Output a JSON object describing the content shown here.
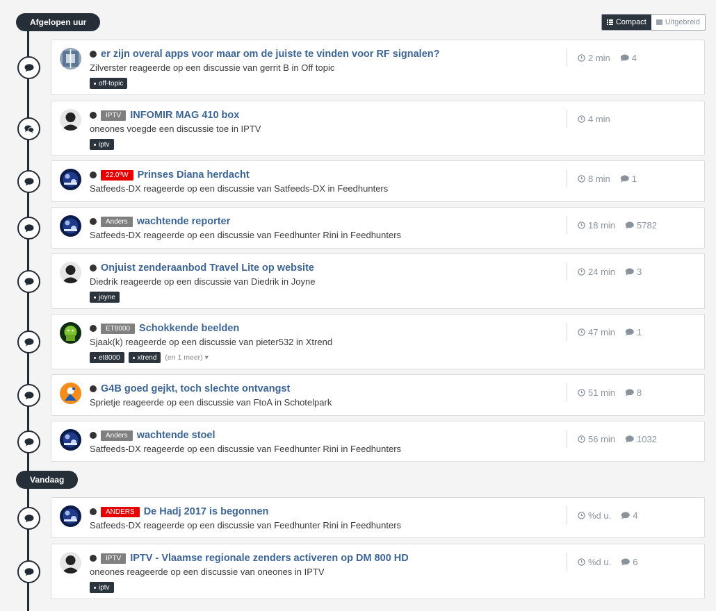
{
  "sections": [
    {
      "label": "Afgelopen uur"
    },
    {
      "label": "Vandaag"
    }
  ],
  "view_switch": {
    "compact_label": "Compact",
    "expanded_label": "Uitgebreid"
  },
  "items": [
    {
      "node_icon": "comment-icon",
      "avatar": "photo",
      "prefix": "",
      "title": "er zijn overal apps voor maar om de juiste te vinden voor RF signalen?",
      "meta": "Zilverster reageerde op een discussie van gerrit B in Off topic",
      "tags": [
        "off-topic"
      ],
      "more": "",
      "time": "2 min",
      "replies": "4"
    },
    {
      "node_icon": "comments-icon",
      "avatar": "default",
      "prefix": "IPTV",
      "prefix_color": "#7f7f7f",
      "title": "INFOMIR MAG 410 box",
      "meta": "oneones voegde een discussie toe in IPTV",
      "tags": [
        "iptv"
      ],
      "more": "",
      "time": "4 min",
      "replies": ""
    },
    {
      "node_icon": "comment-icon",
      "avatar": "satfeeds",
      "prefix": "22.0ºW",
      "prefix_color": "#e60000",
      "title": "Prinses Diana herdacht",
      "meta": "Satfeeds-DX reageerde op een discussie van Satfeeds-DX in Feedhunters",
      "tags": [],
      "more": "",
      "time": "8 min",
      "replies": "1"
    },
    {
      "node_icon": "comment-icon",
      "avatar": "satfeeds",
      "prefix": "Anders",
      "prefix_color": "#7f7f7f",
      "title": "wachtende reporter",
      "meta": "Satfeeds-DX reageerde op een discussie van Feedhunter Rini in Feedhunters",
      "tags": [],
      "more": "",
      "time": "18 min",
      "replies": "5782"
    },
    {
      "node_icon": "comment-icon",
      "avatar": "default",
      "prefix": "",
      "title": "Onjuist zenderaanbod Travel Lite op website",
      "meta": "Diedrik reageerde op een discussie van Diedrik in Joyne",
      "tags": [
        "joyne"
      ],
      "more": "",
      "time": "24 min",
      "replies": "3"
    },
    {
      "node_icon": "comment-icon",
      "avatar": "android",
      "prefix": "ET8000",
      "prefix_color": "#7f7f7f",
      "title": "Schokkende beelden",
      "meta": "Sjaak(k) reageerde op een discussie van pieter532 in Xtrend",
      "tags": [
        "et8000",
        "xtrend"
      ],
      "more": "(en 1 meer)",
      "time": "47 min",
      "replies": "1"
    },
    {
      "node_icon": "comment-icon",
      "avatar": "orange",
      "prefix": "",
      "title": "G4B goed gejkt, toch slechte ontvangst",
      "meta": "Sprietje reageerde op een discussie van FtoA in Schotelpark",
      "tags": [],
      "more": "",
      "time": "51 min",
      "replies": "8"
    },
    {
      "node_icon": "comment-icon",
      "avatar": "satfeeds",
      "prefix": "Anders",
      "prefix_color": "#7f7f7f",
      "title": "wachtende stoel",
      "meta": "Satfeeds-DX reageerde op een discussie van Feedhunter Rini in Feedhunters",
      "tags": [],
      "more": "",
      "time": "56 min",
      "replies": "1032"
    },
    {
      "node_icon": "comment-icon",
      "avatar": "satfeeds",
      "prefix": "ANDERS",
      "prefix_color": "#e60000",
      "title": "De Hadj 2017 is begonnen",
      "meta": "Satfeeds-DX reageerde op een discussie van Feedhunter Rini in Feedhunters",
      "tags": [],
      "more": "",
      "time": "%d u.",
      "replies": "4"
    },
    {
      "node_icon": "comment-icon",
      "avatar": "default",
      "prefix": "IPTV",
      "prefix_color": "#7f7f7f",
      "title": "IPTV - Vlaamse regionale zenders activeren op DM 800 HD",
      "meta": "oneones reageerde op een discussie van oneones in IPTV",
      "tags": [
        "iptv"
      ],
      "more": "",
      "time": "%d u.",
      "replies": "6"
    }
  ]
}
